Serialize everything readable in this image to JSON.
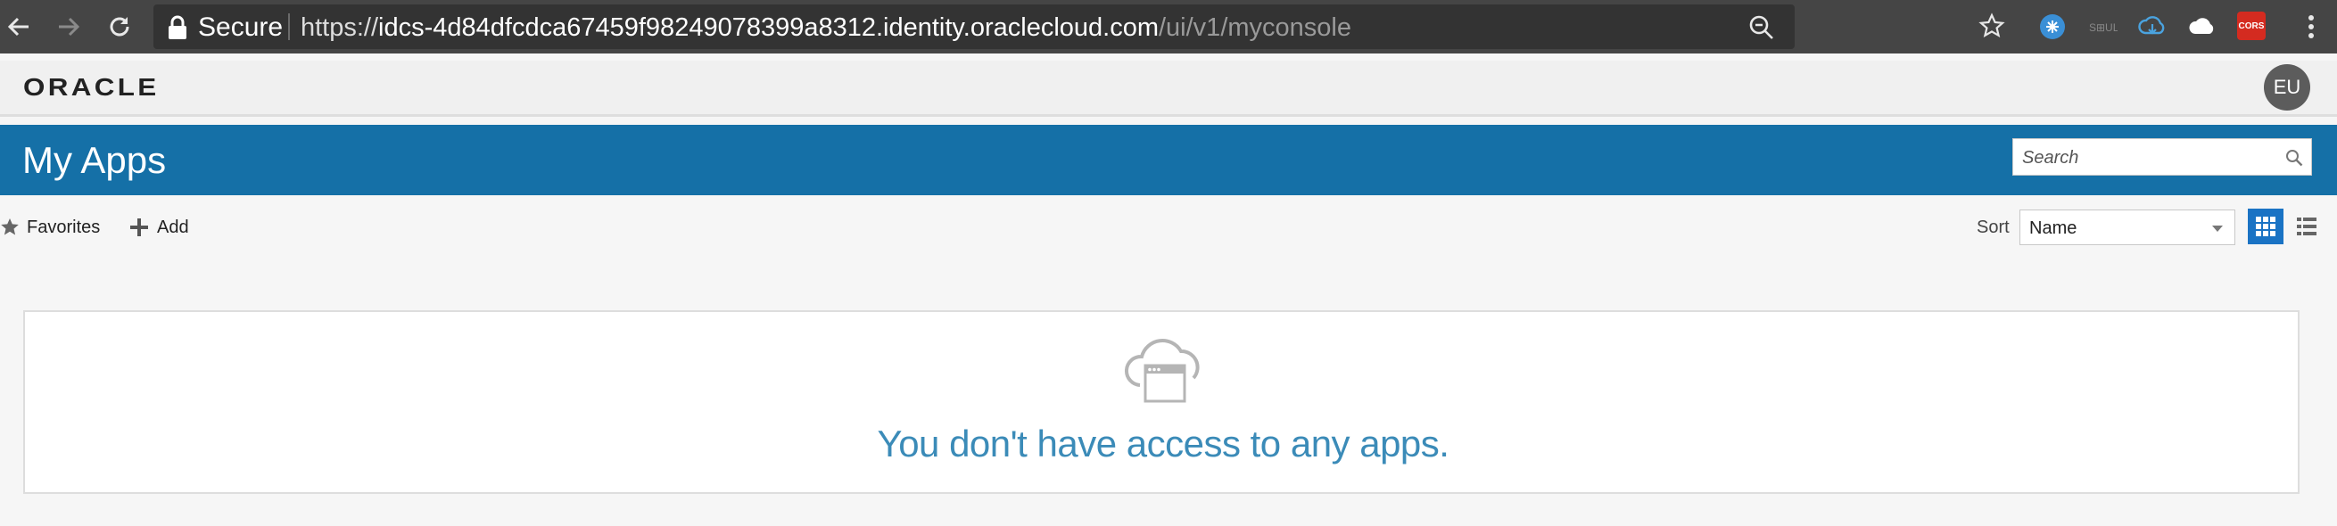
{
  "browser": {
    "secure_label": "Secure",
    "url_scheme": "https://",
    "url_host": "idcs-4d84dfcdca67459f98249078399a8312.identity.oraclecloud.com",
    "url_path": "/ui/v1/myconsole",
    "extensions": [
      "chrome-extension-icon",
      "ext-text-icon",
      "cloud-sync-icon",
      "cloud-icon",
      "cors-icon"
    ],
    "cors_label": "CORS"
  },
  "header": {
    "logo": "ORACLE",
    "avatar_initials": "EU"
  },
  "titlebar": {
    "title": "My Apps",
    "search_placeholder": "Search"
  },
  "toolbar": {
    "favorites_label": "Favorites",
    "add_label": "Add",
    "sort_label": "Sort",
    "sort_value": "Name"
  },
  "empty_state": {
    "message": "You don't have access to any apps."
  },
  "colors": {
    "brand_blue": "#1570a7",
    "accent": "#1a73c4",
    "empty_text": "#3b8bb8"
  }
}
